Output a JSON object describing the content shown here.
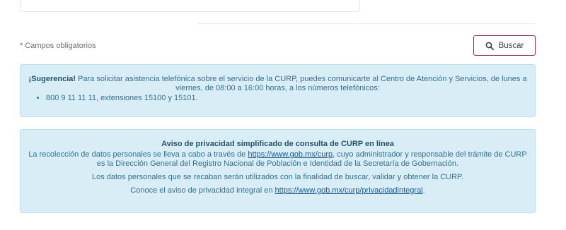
{
  "form": {
    "required_note": "* Campos obligatorios",
    "search_button_label": "Buscar"
  },
  "suggestion": {
    "label": "¡Sugerencia!",
    "text": " Para solicitar asistencia telefónica sobre el servicio de la CURP, puedes comunicarte al Centro de Atención y Servicios, de lunes a viernes, de 08:00 a 16:00 horas, a los números telefónicos:",
    "items": [
      "800 9 11 11 11, extensiones 15100 y 15101."
    ]
  },
  "privacy": {
    "title": "Aviso de privacidad simplificado de consulta de CURP en línea",
    "p1_before": "La recolección de datos personales se lleva a cabo a través de ",
    "p1_link": "https://www.gob.mx/curp",
    "p1_after": ", cuyo administrador y responsable del trámite de CURP es la Dirección General del Registro Nacional de Población e Identidad de la Secretaría de Gobernación.",
    "p2": "Los datos personales que se recaban serán utilizados con la finalidad de buscar, validar y obtener la CURP.",
    "p3_before": "Conoce el aviso de privacidad integral en ",
    "p3_link": "https://www.gob.mx/curp/privacidadintegral",
    "p3_after": "."
  },
  "colors": {
    "accent": "#9d2449",
    "alert_bg": "#d9edf7",
    "alert_text": "#31708f"
  },
  "icons": {
    "search": "search-icon"
  }
}
